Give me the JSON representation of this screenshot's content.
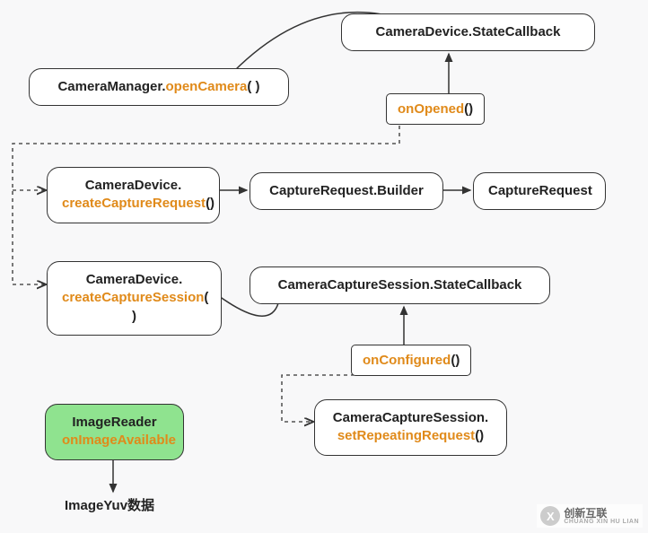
{
  "nodes": {
    "statecb": {
      "prefix": "CameraDevice.",
      "suffix": "StateCallback"
    },
    "opencam": {
      "prefix": "CameraManager.",
      "method": "openCamera",
      "tail": "( )"
    },
    "onopened": {
      "method": "onOpened",
      "tail": "()"
    },
    "createreq": {
      "prefix": "CameraDevice.",
      "method": "createCaptureRequest",
      "tail": "()"
    },
    "builder": {
      "text": "CaptureRequest.Builder"
    },
    "capreq": {
      "text": "CaptureRequest"
    },
    "createsess": {
      "prefix": "CameraDevice.",
      "method": "createCaptureSession",
      "tail": "( )"
    },
    "sesscb": {
      "text": "CameraCaptureSession.StateCallback"
    },
    "onconf": {
      "method": "onConfigured",
      "tail": "()"
    },
    "setrep": {
      "prefix": "CameraCaptureSession.",
      "method": "setRepeatingRequest",
      "tail": "()"
    },
    "imgreader": {
      "line1": "ImageReader",
      "method": "onImageAvailable"
    },
    "imgyuv": {
      "text": "ImageYuv数据"
    }
  },
  "logo": {
    "mark": "X",
    "cn": "创新互联",
    "en": "CHUANG XIN HU LIAN"
  }
}
